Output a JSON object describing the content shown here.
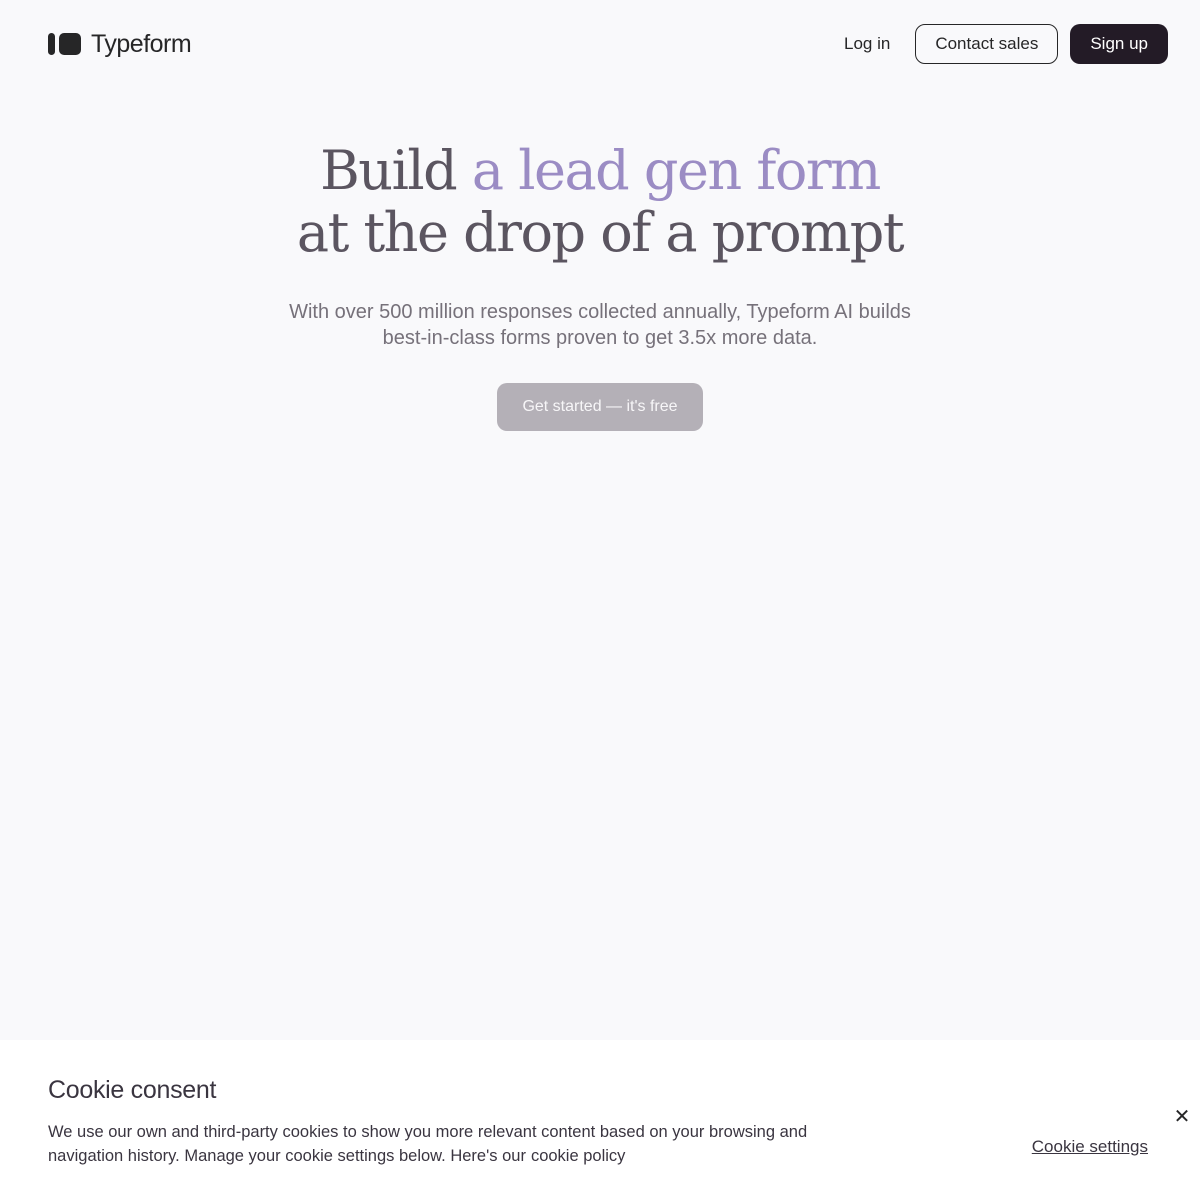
{
  "header": {
    "logo_text": "Typeform",
    "login_label": "Log in",
    "contact_label": "Contact sales",
    "signup_label": "Sign up"
  },
  "hero": {
    "title_prefix": "Build ",
    "title_accent": "a lead gen form",
    "title_line2": "at the drop of a prompt",
    "subtitle_line1": "With over 500 million responses collected annually, Typeform AI builds",
    "subtitle_line2": "best-in-class forms proven to get 3.5x more data.",
    "cta_label": "Get started — it's free"
  },
  "cookie": {
    "title": "Cookie consent",
    "text": "We use our own and third-party cookies to show you more relevant content based on your browsing and navigation history. Manage your cookie settings below. Here's our",
    "policy_link": "cookie policy",
    "settings_label": "Cookie settings",
    "close_icon": "close-icon"
  },
  "colors": {
    "background": "#f9f9fb",
    "dark": "#231b26",
    "accent": "#9b8cc4",
    "cta_disabled": "#b4b0b7"
  }
}
